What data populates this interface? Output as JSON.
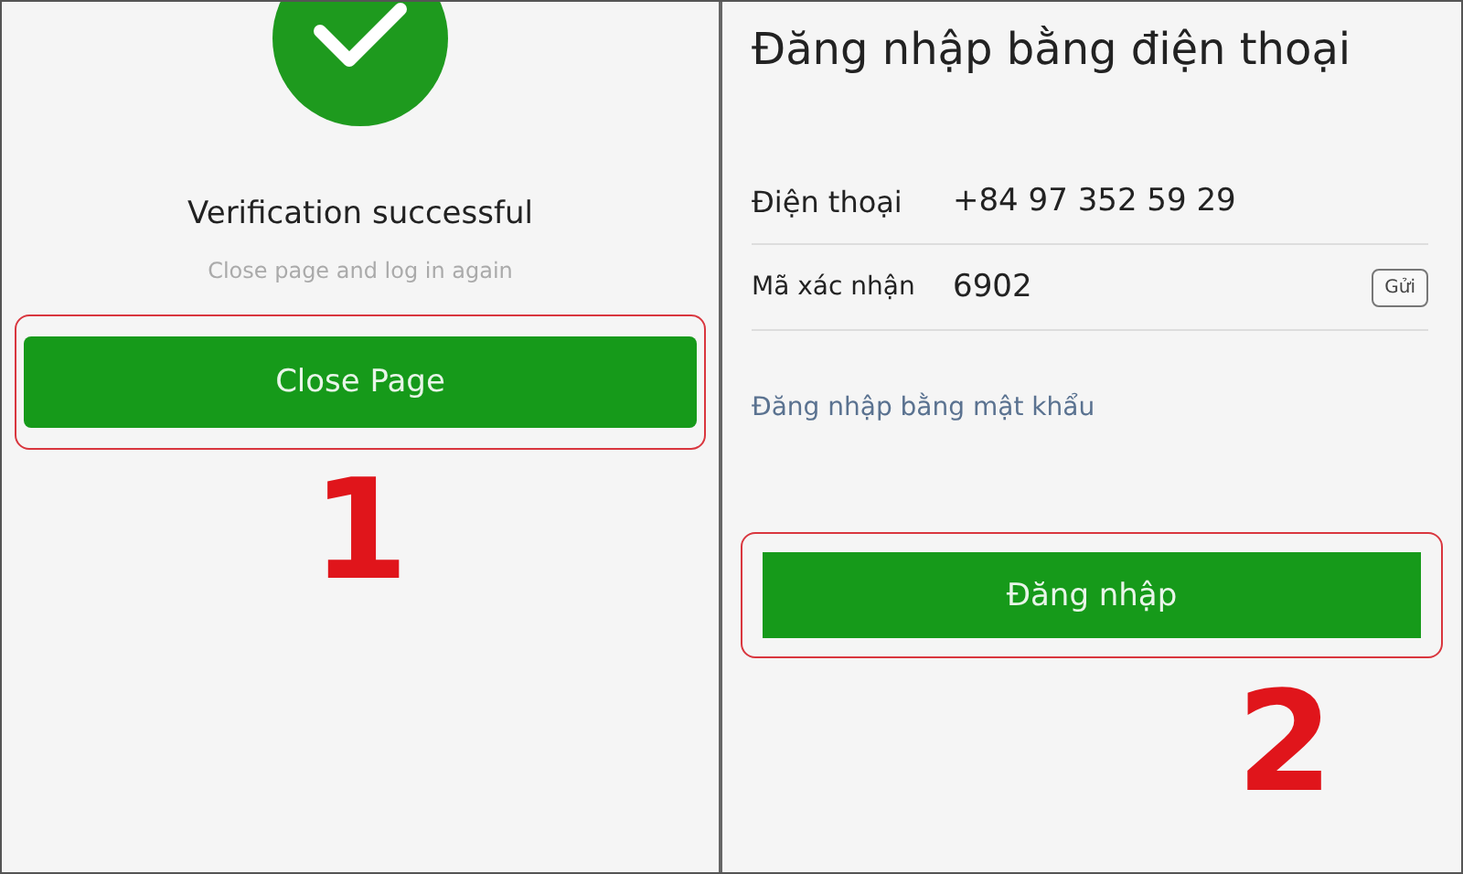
{
  "left_screen": {
    "title": "Verification successful",
    "subtitle": "Close page and log in again",
    "button": "Close Page",
    "step": "1"
  },
  "right_screen": {
    "title": "Đăng nhập bằng điện thoại",
    "fields": [
      {
        "label": "Điện thoại",
        "value": "+84 97 352 59 29"
      },
      {
        "label": "Mã xác nhận",
        "value": "6902",
        "action": "Gửi"
      }
    ],
    "link": "Đăng nhập bằng mật khẩu",
    "button": "Đăng nhập",
    "step": "2"
  }
}
